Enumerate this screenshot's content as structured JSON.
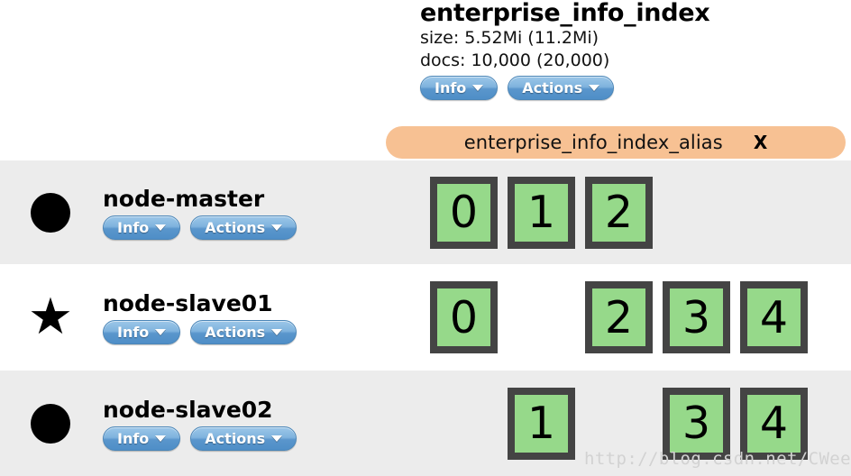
{
  "index": {
    "name": "enterprise_info_index",
    "size_label": "size: 5.52Mi (11.2Mi)",
    "docs_label": "docs: 10,000 (20,000)",
    "info_button": "Info",
    "actions_button": "Actions",
    "alias": {
      "name": "enterprise_info_index_alias",
      "close_label": "X",
      "color": "#f7c193"
    }
  },
  "nodes": [
    {
      "name": "node-master",
      "marker": "circle-icon",
      "is_master": false,
      "row_style": "shaded",
      "info_button": "Info",
      "actions_button": "Actions",
      "shards": [
        {
          "label": "0",
          "state": "started"
        },
        {
          "label": "1",
          "state": "started"
        },
        {
          "label": "2",
          "state": "started"
        },
        {
          "label": "",
          "state": "empty"
        },
        {
          "label": "",
          "state": "empty"
        }
      ]
    },
    {
      "name": "node-slave01",
      "marker": "star-icon",
      "is_master": true,
      "row_style": "plain",
      "info_button": "Info",
      "actions_button": "Actions",
      "shards": [
        {
          "label": "0",
          "state": "started"
        },
        {
          "label": "",
          "state": "empty"
        },
        {
          "label": "2",
          "state": "started"
        },
        {
          "label": "3",
          "state": "started"
        },
        {
          "label": "4",
          "state": "started"
        }
      ]
    },
    {
      "name": "node-slave02",
      "marker": "circle-icon",
      "is_master": false,
      "row_style": "shaded",
      "info_button": "Info",
      "actions_button": "Actions",
      "shards": [
        {
          "label": "",
          "state": "empty"
        },
        {
          "label": "1",
          "state": "started"
        },
        {
          "label": "",
          "state": "empty"
        },
        {
          "label": "3",
          "state": "started"
        },
        {
          "label": "4",
          "state": "started"
        }
      ]
    }
  ],
  "colors": {
    "shard_started_fill": "#96d98a",
    "shard_border": "#444444",
    "row_shaded": "#ececec",
    "row_plain": "#ffffff",
    "button_blue": "#5a96cc"
  },
  "watermark": {
    "text": "http://blog.csdn.net/CWeeYii"
  },
  "markers": {
    "circle": "●",
    "star": "★"
  }
}
